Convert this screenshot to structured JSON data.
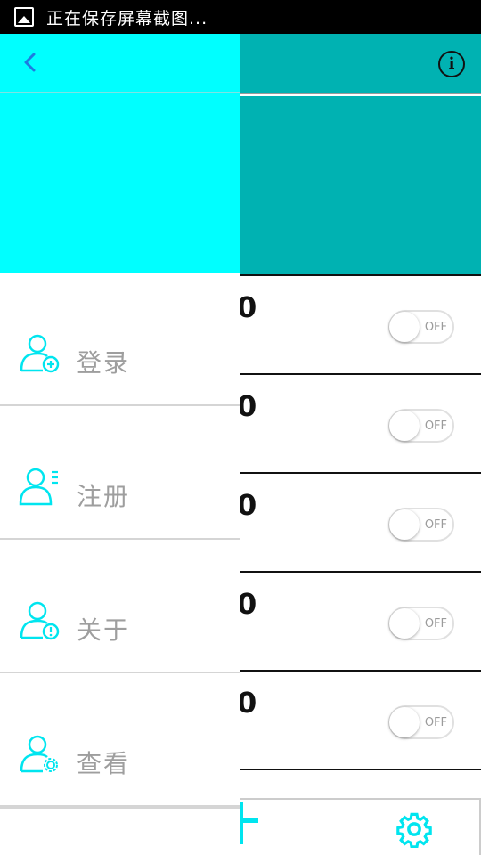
{
  "status_bar": {
    "notification": "正在保存屏幕截图..."
  },
  "main": {
    "rows": [
      {
        "number": "0",
        "toggle": "OFF"
      },
      {
        "number": "0",
        "toggle": "OFF"
      },
      {
        "number": "0",
        "toggle": "OFF"
      },
      {
        "number": "0",
        "toggle": "OFF"
      },
      {
        "number": "0",
        "toggle": "OFF"
      }
    ],
    "info_icon": "i"
  },
  "drawer": {
    "menu": [
      {
        "label": "登录",
        "icon": "user-add-icon"
      },
      {
        "label": "注册",
        "icon": "user-list-icon"
      },
      {
        "label": "关于",
        "icon": "user-info-icon"
      },
      {
        "label": "查看",
        "icon": "user-settings-icon"
      }
    ]
  },
  "colors": {
    "drawer_header": "#00ffff",
    "topbar": "#00b2b2",
    "icon": "#00e5ef",
    "back_arrow": "#1e7be0"
  }
}
